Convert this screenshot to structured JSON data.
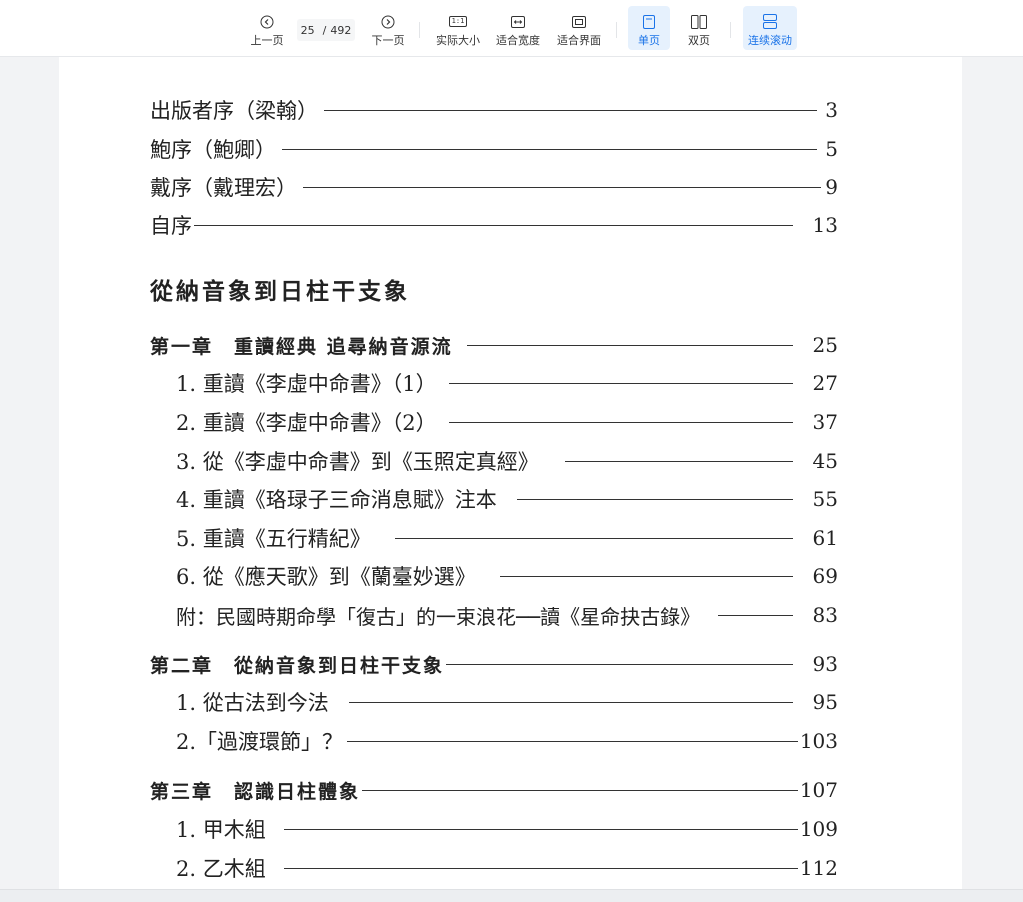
{
  "toolbar": {
    "prev": "上一页",
    "next": "下一页",
    "current_page": "25",
    "page_sep": "/",
    "total_pages": "492",
    "actual_size": "实际大小",
    "actual_size_icon": "1:1",
    "fit_width": "适合宽度",
    "fit_page": "适合界面",
    "single_page": "单页",
    "double_page": "双页",
    "continuous": "连续滚动",
    "accent_color": "#1a73e8"
  },
  "toc": {
    "prefaces": [
      {
        "title": "出版者序（梁翰）",
        "page": "3"
      },
      {
        "title": "鮑序（鮑卿）",
        "page": "5"
      },
      {
        "title": "戴序（戴理宏）",
        "page": "9"
      },
      {
        "title": "自序",
        "page": "13"
      }
    ],
    "part_title": "從納音象到日柱干支象",
    "chapter1": {
      "title": "第一章　重讀經典 追尋納音源流",
      "page": "25",
      "items": [
        {
          "title": "1. 重讀《李虛中命書》（1）",
          "page": "27"
        },
        {
          "title": "2. 重讀《李虛中命書》（2）",
          "page": "37"
        },
        {
          "title": "3. 從《李虛中命書》到《玉照定真經》",
          "page": "45"
        },
        {
          "title": "4. 重讀《珞琭子三命消息賦》注本",
          "page": "55"
        },
        {
          "title": "5. 重讀《五行精紀》",
          "page": "61"
        },
        {
          "title": "6. 從《應天歌》到《蘭臺妙選》",
          "page": "69"
        },
        {
          "title": "附：民國時期命學「復古」的一束浪花──讀《星命抉古錄》",
          "page": "83"
        }
      ]
    },
    "chapter2": {
      "title": "第二章　從納音象到日柱干支象",
      "page": "93",
      "items": [
        {
          "title": "1. 從古法到今法",
          "page": "95"
        },
        {
          "title": "2.「過渡環節」？",
          "page": "103"
        }
      ]
    },
    "chapter3": {
      "title": "第三章　認識日柱體象",
      "page": "107",
      "items": [
        {
          "title": "1. 甲木組",
          "page": "109"
        },
        {
          "title": "2. 乙木組",
          "page": "112"
        }
      ]
    }
  }
}
